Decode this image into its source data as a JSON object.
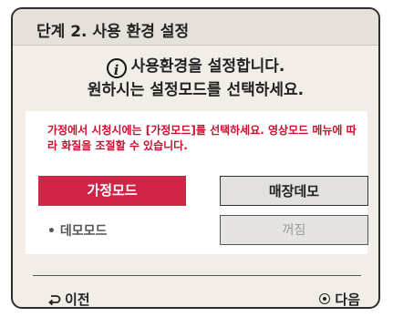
{
  "dialog": {
    "title": "단계 2. 사용 환경 설정",
    "intro_line1": "사용환경을 설정합니다.",
    "intro_line2": "원하시는 설정모드를 선택하세요.",
    "info_icon": "info-icon"
  },
  "panel": {
    "notice": "가정에서 시청시에는 [가정모드]를 선택하세요. 영상모드 메뉴에 따라 화질을 조절할 수 있습니다.",
    "home_mode_label": "가정모드",
    "store_demo_label": "매장데모",
    "demo_mode_label": "• 데모모드",
    "demo_mode_value": "꺼짐"
  },
  "footer": {
    "back_label": "이전",
    "back_icon": "return-icon",
    "next_label": "다음",
    "next_icon": "ok-button-icon"
  },
  "colors": {
    "accent": "#d02547",
    "notice": "#c8102e",
    "background": "#f2ede7"
  }
}
